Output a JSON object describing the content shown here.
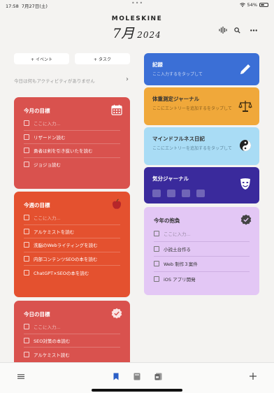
{
  "status": {
    "time": "17:58",
    "date": "7月27日(土)",
    "dots": "•••",
    "battery": "54%",
    "battery_level": 0.54
  },
  "header": {
    "brand": "MOLESKINE",
    "month": "7月",
    "year": "2024"
  },
  "icons": {
    "voice": "waveform-icon",
    "search": "search-icon",
    "more": "more-icon",
    "month_goal": "calendar-icon",
    "week_goal": "apple-icon",
    "day_goal": "check-badge-icon",
    "record": "pen-icon",
    "weight": "scale-icon",
    "mindful": "yin-yang-icon",
    "mood": "mask-icon",
    "year": "check-badge-icon"
  },
  "actions": {
    "event": "+ イベント",
    "task": "+ タスク"
  },
  "activity": {
    "text": "今日は何もアクティビティがありません"
  },
  "month_goal": {
    "title": "今月の目標",
    "color": "#d9524e",
    "items": [
      "ここに入力...",
      "リザードン読む",
      "勇者は剣を引き抜いたを読む",
      "ジョジョ読む"
    ]
  },
  "week_goal": {
    "title": "今週の目標",
    "color": "#e4512f",
    "items": [
      "ここに入力...",
      "アルケミストを読む",
      "洗脳のWebライティングを読む",
      "内部コンテンツSEOの本を読む",
      "ChatGPT×SEOの本を読む"
    ]
  },
  "day_goal": {
    "title": "今日の目標",
    "color": "#d9524e",
    "items": [
      "ここに入力...",
      "SEO対策の本読む",
      "アルケミスト読む"
    ]
  },
  "journals": {
    "record": {
      "title": "記録",
      "subtitle": "ここ入力するをタップして",
      "color": "#3b6fd6"
    },
    "weight": {
      "title": "体重測定ジャーナル",
      "subtitle": "ここにエントリーを追加するをタップして",
      "color": "#f0a83a"
    },
    "mindful": {
      "title": "マインドフルネス日記",
      "subtitle": "ここにエントリーを追加するをタップして",
      "color": "#a9dcf5"
    },
    "mood": {
      "title": "気分ジャーナル",
      "color": "#3a2a9c"
    }
  },
  "year_goal": {
    "title": "今年の抱負",
    "items": [
      "ここに入力...",
      "小説土台作る",
      "Web 制作３案件",
      "iOS アプリ開発"
    ]
  },
  "bottom_nav": {
    "menu": "menu-icon",
    "bookmark": "bookmark-icon",
    "book": "book-icon",
    "notebook": "notebook-icon",
    "add": "plus-icon"
  }
}
